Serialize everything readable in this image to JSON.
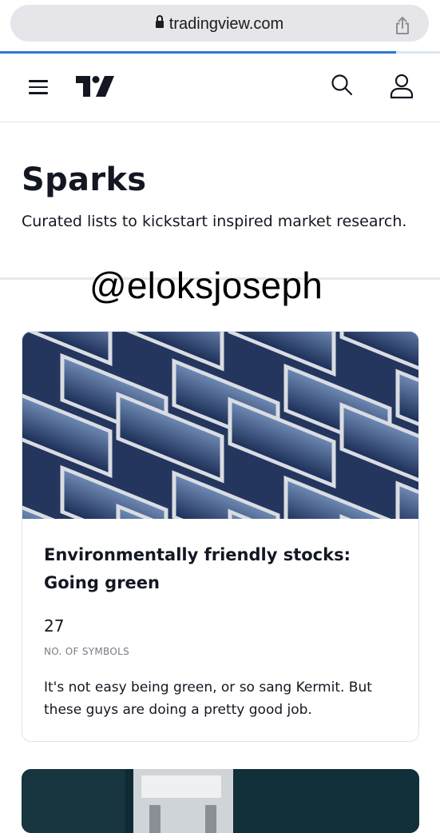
{
  "browser": {
    "url": "tradingview.com",
    "lock_icon": "lock-icon",
    "share_icon": "share-icon",
    "load_progress": 0.9
  },
  "header": {
    "menu_icon": "hamburger-icon",
    "logo_icon": "tradingview-logo",
    "search_icon": "search-icon",
    "user_icon": "user-icon"
  },
  "hero": {
    "title": "Sparks",
    "subtitle": "Curated lists to kickstart inspired market research."
  },
  "watermark": "@eloksjoseph",
  "cards": [
    {
      "title": "Environmentally friendly stocks: Going green",
      "count": "27",
      "count_label": "NO. OF SYMBOLS",
      "description": "It's not easy being green, or so sang Kermit. But these guys are doing a pretty good job."
    }
  ],
  "colors": {
    "accent": "#2a78d6",
    "text": "#131722",
    "muted": "#787b86"
  }
}
